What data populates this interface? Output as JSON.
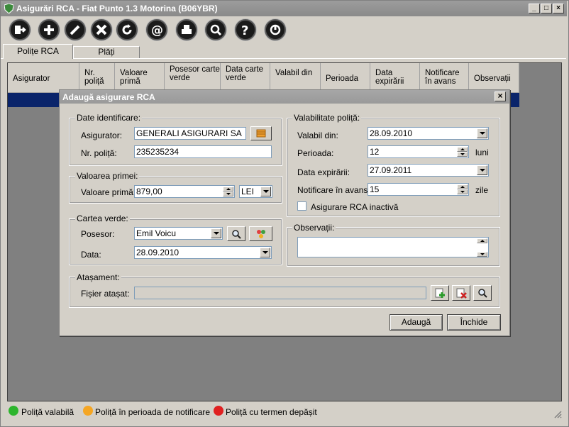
{
  "window": {
    "title": "Asigurări RCA - Fiat Punto 1.3 Motorina (B06YBR)"
  },
  "toolbar": {
    "icons": [
      "exit-icon",
      "add-icon",
      "edit-icon",
      "delete-icon",
      "refresh-icon",
      "email-icon",
      "print-icon",
      "search-icon",
      "help-icon",
      "power-icon"
    ]
  },
  "tabs": [
    {
      "label": "Polițe RCA"
    },
    {
      "label": "Plăți"
    }
  ],
  "grid": {
    "columns": [
      "Asigurator",
      "Nr. poliță",
      "Valoare primă",
      "Posesor carte verde",
      "Data carte verde",
      "Valabil din",
      "Perioada",
      "Data expirării",
      "Notificare în avans",
      "Observații"
    ]
  },
  "legend": [
    {
      "label": "Poliță valabilă",
      "color": "#2db52d"
    },
    {
      "label": "Poliță în perioada de notificare",
      "color": "#f5a623"
    },
    {
      "label": "Poliță cu termen depășit",
      "color": "#e02020"
    }
  ],
  "dialog": {
    "title": "Adaugă asigurare RCA",
    "identificare": {
      "legend": "Date identificare:",
      "asigurator_label": "Asigurator:",
      "asigurator_value": "GENERALI ASIGURARI SA",
      "nr_label": "Nr. poliță:",
      "nr_value": "235235234"
    },
    "prima": {
      "legend": "Valoarea primei:",
      "label": "Valoare primă:",
      "value": "879,00",
      "currency": "LEI"
    },
    "carte": {
      "legend": "Cartea verde:",
      "posesor_label": "Posesor:",
      "posesor_value": "Emil Voicu",
      "data_label": "Data:",
      "data_value": "28.09.2010"
    },
    "valabilitate": {
      "legend": "Valabilitate poliță:",
      "valabil_label": "Valabil din:",
      "valabil_value": "28.09.2010",
      "perioada_label": "Perioada:",
      "perioada_value": "12",
      "perioada_unit": "luni",
      "expirare_label": "Data expirării:",
      "expirare_value": "27.09.2011",
      "notif_label": "Notificare în avans:",
      "notif_value": "15",
      "notif_unit": "zile",
      "inactiv_label": "Asigurare RCA inactivă"
    },
    "observatii": {
      "legend": "Observații:",
      "value": ""
    },
    "atasament": {
      "legend": "Atașament:",
      "label": "Fișier atașat:",
      "value": ""
    },
    "buttons": {
      "add": "Adaugă",
      "close": "Închide"
    }
  }
}
